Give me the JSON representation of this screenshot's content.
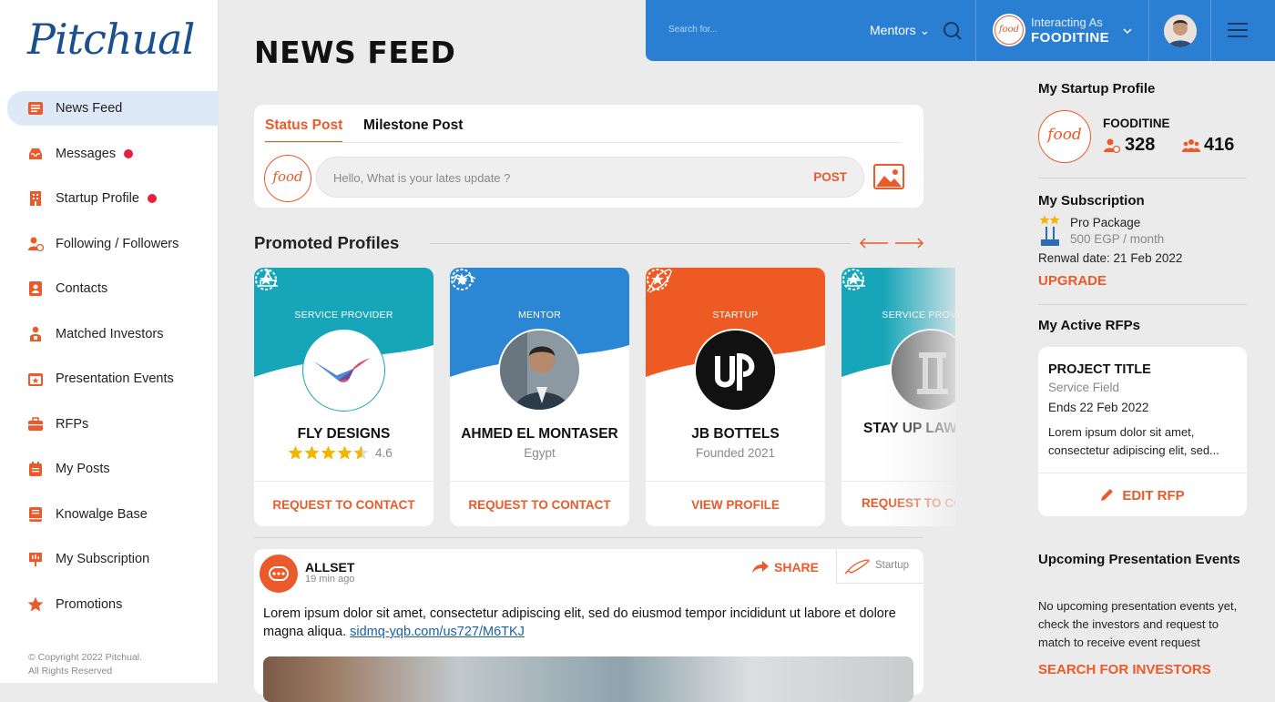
{
  "app": {
    "logo_text": "Pitchual"
  },
  "sidebar": {
    "items": [
      {
        "label": "News Feed",
        "icon": "newspaper-icon",
        "active": true,
        "dot": false
      },
      {
        "label": "Messages",
        "icon": "inbox-icon",
        "active": false,
        "dot": true
      },
      {
        "label": "Startup Profile",
        "icon": "building-icon",
        "active": false,
        "dot": true
      },
      {
        "label": "Following / Followers",
        "icon": "user-follow-icon",
        "active": false,
        "dot": false
      },
      {
        "label": "Contacts",
        "icon": "contact-card-icon",
        "active": false,
        "dot": false
      },
      {
        "label": "Matched Investors",
        "icon": "investor-icon",
        "active": false,
        "dot": false
      },
      {
        "label": "Presentation Events",
        "icon": "calendar-star-icon",
        "active": false,
        "dot": false
      },
      {
        "label": "RFPs",
        "icon": "briefcase-icon",
        "active": false,
        "dot": false
      },
      {
        "label": "My Posts",
        "icon": "posts-icon",
        "active": false,
        "dot": false
      },
      {
        "label": "Knowalge Base",
        "icon": "book-icon",
        "active": false,
        "dot": false
      },
      {
        "label": "My Subscription",
        "icon": "subscription-icon",
        "active": false,
        "dot": false
      },
      {
        "label": "Promotions",
        "icon": "star-icon",
        "active": false,
        "dot": false
      }
    ],
    "copyright_line1": "© Copyright 2022 Pitchual.",
    "copyright_line2": "All Rights Reserved"
  },
  "header": {
    "page_title": "NEWS FEED",
    "search_placeholder": "Search for...",
    "search_scope": "Mentors",
    "interacting_label": "Interacting As",
    "interacting_name": "FOODITINE"
  },
  "status_post": {
    "tab_status": "Status Post",
    "tab_milestone": "Milestone Post",
    "placeholder": "Hello, What is your lates update ?",
    "post_label": "POST",
    "avatar_text": "food"
  },
  "promoted": {
    "title": "Promoted Profiles",
    "cards": [
      {
        "type": "SERVICE PROVIDER",
        "name": "FLY DESIGNS",
        "sub": "",
        "rating": 4.6,
        "rating_text": "4.6",
        "action": "REQUEST TO CONTACT",
        "color": "#16a5b9"
      },
      {
        "type": "MENTOR",
        "name": "AHMED EL MONTASER",
        "sub": "Egypt",
        "action": "REQUEST TO CONTACT",
        "color": "#2b87d4"
      },
      {
        "type": "STARTUP",
        "name": "JB BOTTELS",
        "sub": "Founded 2021",
        "action": "VIEW PROFILE",
        "color": "#ee5a24"
      },
      {
        "type": "SERVICE PROVIDER",
        "name": "STAY UP LAW",
        "sub": "",
        "action": "REQUEST TO CONTACT",
        "color": "#16a5b9"
      }
    ]
  },
  "post": {
    "author": "ALLSET",
    "time": "19 min ago",
    "share_label": "SHARE",
    "tag": "Startup",
    "text": "Lorem ipsum dolor sit amet, consectetur adipiscing elit, sed do eiusmod tempor incididunt ut labore et dolore magna aliqua.",
    "link": "sidmq-yqb.com/us727/M6TKJ"
  },
  "right": {
    "startup_title": "My Startup Profile",
    "startup_name": "FOODITINE",
    "followers": "328",
    "following": "416",
    "subscription_title": "My Subscription",
    "package": "Pro Package",
    "price": "500 EGP / month",
    "renewal": "Renwal date: 21 Feb 2022",
    "upgrade": "UPGRADE",
    "rfps_title": "My Active RFPs",
    "rfp_title": "PROJECT TITLE",
    "rfp_field": "Service Field",
    "rfp_ends": "Ends 22 Feb 2022",
    "rfp_desc": "Lorem ipsum dolor sit amet, consectetur adipiscing elit, sed...",
    "rfp_edit": "EDIT RFP",
    "events_title": "Upcoming Presentation Events",
    "events_text": "No upcoming presentation events yet, check the investors and request to match to receive event request",
    "events_link": "SEARCH FOR  INVESTORS"
  },
  "colors": {
    "accent": "#ea5a2b",
    "primary": "#2b7fd3",
    "teal": "#16a5b9",
    "star": "#f4b400"
  }
}
